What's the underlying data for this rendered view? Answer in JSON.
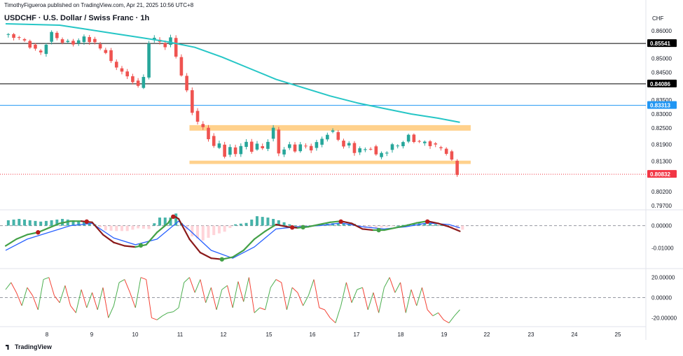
{
  "header": {
    "publisher": "TimothyFigueroa published on TradingView.com, Apr 21, 2025 10:56 UTC+8",
    "title": "USDCHF · U.S. Dollar / Swiss Franc · 1h",
    "currency": "CHF",
    "footer_brand": "TradingView"
  },
  "colors": {
    "up_candle": "#26a69a",
    "down_candle": "#ef5350",
    "ema": "#26c6c6",
    "zone": "#ffcc80",
    "osc_green": "#43a047",
    "osc_dark_red": "#8b1a1a",
    "osc_blue": "#2962ff",
    "rsi_up": "#4caf50",
    "rsi_down": "#f44336"
  },
  "chart_data": [
    {
      "type": "candlestick",
      "ylim": [
        0.7965,
        0.8635
      ],
      "price_ticks": [
        "0.86000",
        "0.85000",
        "0.84500",
        "0.83500",
        "0.83000",
        "0.82500",
        "0.81900",
        "0.81300",
        "0.80200",
        "0.79700"
      ],
      "x_labels": [
        "8",
        "9",
        "10",
        "11",
        "12",
        "15",
        "16",
        "17",
        "18",
        "19",
        "22",
        "23",
        "24",
        "25"
      ],
      "horizontal_lines": [
        {
          "label": "0.85541",
          "value": 0.85541,
          "color": "#000000"
        },
        {
          "label": "0.84086",
          "value": 0.84086,
          "color": "#000000"
        },
        {
          "label": "0.83313",
          "value": 0.83313,
          "color": "#2196f3"
        },
        {
          "label": "0.80832",
          "value": 0.80832,
          "color": "#f23645",
          "dotted": true
        }
      ],
      "zones": [
        {
          "from": 0.824,
          "to": 0.826
        },
        {
          "from": 0.812,
          "to": 0.8132
        }
      ],
      "close_path": [
        [
          0,
          0.8585
        ],
        [
          3,
          0.8575
        ],
        [
          5,
          0.8545
        ],
        [
          7,
          0.852
        ],
        [
          8,
          0.8555
        ],
        [
          9,
          0.859
        ],
        [
          10,
          0.8575
        ],
        [
          11,
          0.856
        ],
        [
          13,
          0.8555
        ],
        [
          15,
          0.8575
        ],
        [
          17,
          0.8555
        ],
        [
          18,
          0.8535
        ],
        [
          19,
          0.8525
        ],
        [
          20,
          0.8485
        ],
        [
          21,
          0.847
        ],
        [
          22,
          0.8455
        ],
        [
          23,
          0.843
        ],
        [
          24,
          0.842
        ],
        [
          25,
          0.84
        ],
        [
          26,
          0.843
        ],
        [
          27,
          0.856
        ],
        [
          28,
          0.857
        ],
        [
          29,
          0.856
        ],
        [
          30,
          0.8545
        ],
        [
          31,
          0.857
        ],
        [
          32,
          0.851
        ],
        [
          33,
          0.844
        ],
        [
          34,
          0.838
        ],
        [
          35,
          0.831
        ],
        [
          36,
          0.827
        ],
        [
          37,
          0.825
        ],
        [
          38,
          0.8215
        ],
        [
          39,
          0.818
        ],
        [
          40,
          0.8195
        ],
        [
          41,
          0.815
        ],
        [
          42,
          0.8175
        ],
        [
          43,
          0.816
        ],
        [
          44,
          0.8185
        ],
        [
          45,
          0.8195
        ],
        [
          46,
          0.817
        ],
        [
          47,
          0.819
        ],
        [
          48,
          0.8175
        ],
        [
          49,
          0.8205
        ],
        [
          50,
          0.8245
        ],
        [
          51,
          0.816
        ],
        [
          52,
          0.8175
        ],
        [
          53,
          0.8185
        ],
        [
          54,
          0.817
        ],
        [
          55,
          0.819
        ],
        [
          56,
          0.818
        ],
        [
          57,
          0.8175
        ],
        [
          58,
          0.8195
        ],
        [
          59,
          0.821
        ],
        [
          60,
          0.823
        ],
        [
          61,
          0.8235
        ],
        [
          62,
          0.821
        ],
        [
          63,
          0.8185
        ],
        [
          64,
          0.819
        ],
        [
          65,
          0.8165
        ],
        [
          66,
          0.8175
        ],
        [
          67,
          0.817
        ],
        [
          68,
          0.818
        ],
        [
          69,
          0.815
        ],
        [
          70,
          0.816
        ],
        [
          71,
          0.8165
        ],
        [
          72,
          0.8185
        ],
        [
          73,
          0.819
        ],
        [
          74,
          0.82
        ],
        [
          75,
          0.822
        ],
        [
          76,
          0.8205
        ],
        [
          77,
          0.82
        ],
        [
          78,
          0.8198
        ],
        [
          79,
          0.819
        ],
        [
          80,
          0.8185
        ],
        [
          81,
          0.8178
        ],
        [
          82,
          0.816
        ],
        [
          83,
          0.813
        ],
        [
          84,
          0.8085
        ]
      ],
      "ema_path": [
        [
          0,
          0.8625
        ],
        [
          10,
          0.862
        ],
        [
          15,
          0.8605
        ],
        [
          20,
          0.859
        ],
        [
          25,
          0.8575
        ],
        [
          30,
          0.856
        ],
        [
          35,
          0.854
        ],
        [
          40,
          0.8505
        ],
        [
          45,
          0.8465
        ],
        [
          50,
          0.8425
        ],
        [
          55,
          0.8395
        ],
        [
          60,
          0.8365
        ],
        [
          65,
          0.834
        ],
        [
          70,
          0.832
        ],
        [
          75,
          0.83
        ],
        [
          80,
          0.8285
        ],
        [
          84,
          0.827
        ]
      ]
    },
    {
      "type": "oscillator",
      "ylim": [
        -0.0185,
        0.0058
      ],
      "ticks": [
        "0.00000",
        "-0.01000"
      ],
      "fast_path": [
        [
          0,
          -0.009
        ],
        [
          2,
          -0.006
        ],
        [
          4,
          -0.004
        ],
        [
          6,
          -0.003
        ],
        [
          8,
          -0.001
        ],
        [
          10,
          0.001
        ],
        [
          12,
          0.002
        ],
        [
          14,
          0.002
        ],
        [
          16,
          0.0015
        ],
        [
          18,
          -0.004
        ],
        [
          20,
          -0.0075
        ],
        [
          22,
          -0.009
        ],
        [
          24,
          -0.0095
        ],
        [
          26,
          -0.0085
        ],
        [
          28,
          -0.003
        ],
        [
          30,
          0.001
        ],
        [
          31,
          0.0045
        ],
        [
          32,
          0.003
        ],
        [
          34,
          -0.006
        ],
        [
          36,
          -0.012
        ],
        [
          38,
          -0.0145
        ],
        [
          40,
          -0.015
        ],
        [
          42,
          -0.014
        ],
        [
          44,
          -0.011
        ],
        [
          46,
          -0.006
        ],
        [
          48,
          -0.0025
        ],
        [
          50,
          0.0005
        ],
        [
          52,
          -0.0005
        ],
        [
          54,
          -0.001
        ],
        [
          56,
          -0.0005
        ],
        [
          58,
          0.0005
        ],
        [
          60,
          0.0015
        ],
        [
          62,
          0.002
        ],
        [
          64,
          0.001
        ],
        [
          66,
          -0.0015
        ],
        [
          68,
          -0.002
        ],
        [
          70,
          -0.002
        ],
        [
          72,
          -0.001
        ],
        [
          74,
          0.0
        ],
        [
          76,
          0.0012
        ],
        [
          78,
          0.002
        ],
        [
          80,
          0.001
        ],
        [
          82,
          -0.0005
        ],
        [
          84,
          -0.0025
        ]
      ],
      "slow_path": [
        [
          0,
          -0.011
        ],
        [
          4,
          -0.006
        ],
        [
          8,
          -0.003
        ],
        [
          12,
          0.0
        ],
        [
          16,
          0.001
        ],
        [
          20,
          -0.0055
        ],
        [
          24,
          -0.0085
        ],
        [
          28,
          -0.006
        ],
        [
          32,
          0.002
        ],
        [
          34,
          -0.002
        ],
        [
          38,
          -0.011
        ],
        [
          42,
          -0.0145
        ],
        [
          46,
          -0.0095
        ],
        [
          50,
          -0.0015
        ],
        [
          54,
          -0.0005
        ],
        [
          58,
          0.0
        ],
        [
          62,
          0.0012
        ],
        [
          66,
          -0.0005
        ],
        [
          70,
          -0.0015
        ],
        [
          74,
          -0.0005
        ],
        [
          78,
          0.0012
        ],
        [
          82,
          0.0005
        ],
        [
          84,
          -0.001
        ]
      ],
      "cross_markers": [
        {
          "x": 6,
          "value": -0.003,
          "kind": "down"
        },
        {
          "x": 15,
          "value": 0.0018,
          "kind": "down"
        },
        {
          "x": 25,
          "value": -0.0088,
          "kind": "up"
        },
        {
          "x": 31,
          "value": 0.004,
          "kind": "down"
        },
        {
          "x": 40,
          "value": -0.015,
          "kind": "up"
        },
        {
          "x": 53,
          "value": -0.0008,
          "kind": "down"
        },
        {
          "x": 55,
          "value": -0.0007,
          "kind": "up"
        },
        {
          "x": 62,
          "value": 0.0018,
          "kind": "down"
        },
        {
          "x": 69,
          "value": -0.002,
          "kind": "up"
        },
        {
          "x": 78,
          "value": 0.0018,
          "kind": "down"
        }
      ]
    },
    {
      "type": "line",
      "ylim": [
        -28,
        26
      ],
      "ticks": [
        "20.00000",
        "0.00000",
        "-20.00000"
      ],
      "values": [
        8,
        15,
        5,
        -8,
        10,
        2,
        -12,
        18,
        20,
        2,
        -5,
        12,
        -8,
        -15,
        8,
        -10,
        5,
        -12,
        10,
        -20,
        -8,
        15,
        18,
        5,
        -10,
        20,
        18,
        -20,
        -22,
        -18,
        -15,
        -14,
        -10,
        15,
        20,
        5,
        18,
        -5,
        10,
        -12,
        8,
        12,
        -10,
        16,
        -4,
        20,
        -15,
        -10,
        -12,
        10,
        18,
        15,
        -12,
        10,
        5,
        -8,
        2,
        18,
        -10,
        -12,
        -20,
        -25,
        -8,
        15,
        -5,
        8,
        10,
        -12,
        5,
        -15,
        10,
        20,
        5,
        15,
        -15,
        8,
        -8,
        10,
        -12,
        -18,
        -15,
        -22,
        -25,
        -18,
        -12
      ]
    }
  ]
}
